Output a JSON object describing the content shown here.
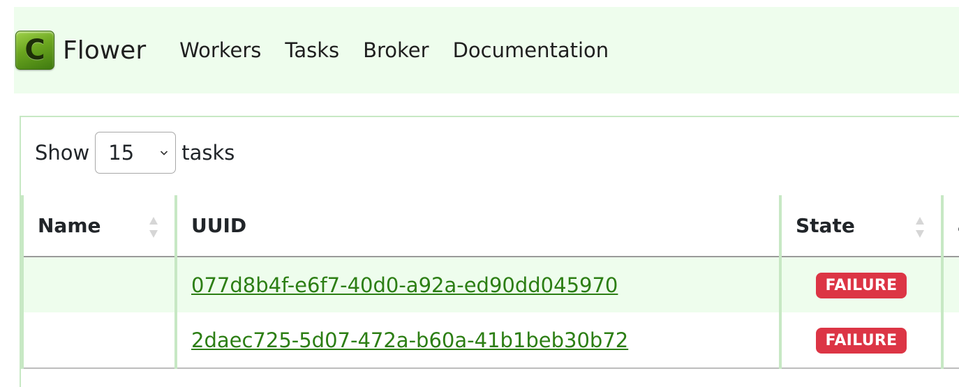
{
  "brand": {
    "logo_letter": "C",
    "name": "Flower"
  },
  "nav": {
    "items": [
      {
        "label": "Workers"
      },
      {
        "label": "Tasks"
      },
      {
        "label": "Broker"
      },
      {
        "label": "Documentation"
      }
    ]
  },
  "length_menu": {
    "prefix": "Show",
    "value": "15",
    "suffix": "tasks"
  },
  "table": {
    "columns": [
      {
        "label": "Name"
      },
      {
        "label": "UUID"
      },
      {
        "label": "State"
      },
      {
        "label": "a"
      }
    ],
    "rows": [
      {
        "name": "",
        "uuid": "077d8b4f-e6f7-40d0-a92a-ed90dd045970",
        "state": "FAILURE"
      },
      {
        "name": "",
        "uuid": "2daec725-5d07-472a-b60a-41b1beb30b72",
        "state": "FAILURE"
      }
    ]
  },
  "colors": {
    "navbar_bg": "#eefded",
    "border_green": "#c7e8c4",
    "link_green": "#2c7e14",
    "failure_badge": "#dc3545"
  }
}
